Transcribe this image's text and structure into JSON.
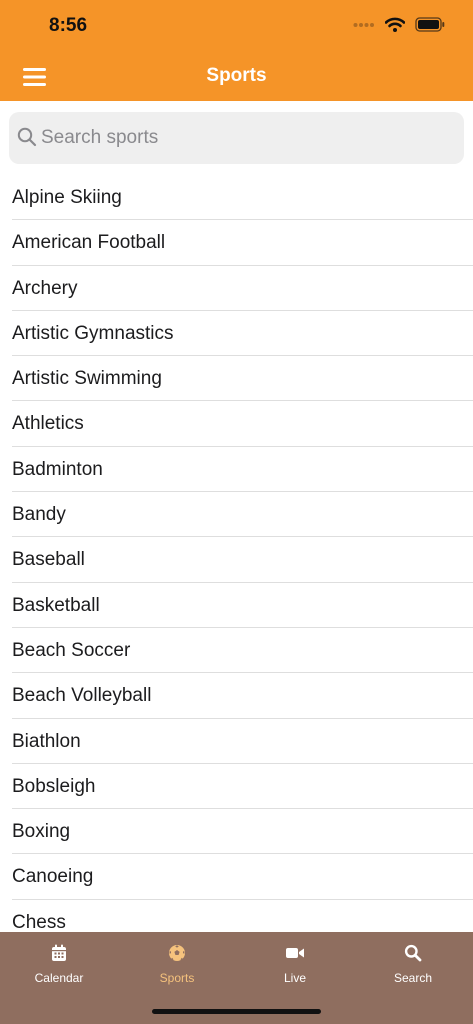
{
  "status_bar": {
    "time": "8:56"
  },
  "nav": {
    "title": "Sports"
  },
  "search": {
    "placeholder": "Search sports",
    "value": ""
  },
  "sports": [
    "Alpine Skiing",
    "American Football",
    "Archery",
    "Artistic Gymnastics",
    "Artistic Swimming",
    "Athletics",
    "Badminton",
    "Bandy",
    "Baseball",
    "Basketball",
    "Beach Soccer",
    "Beach Volleyball",
    "Biathlon",
    "Bobsleigh",
    "Boxing",
    "Canoeing",
    "Chess"
  ],
  "tabs": [
    {
      "label": "Calendar",
      "icon": "calendar-icon"
    },
    {
      "label": "Sports",
      "icon": "soccer-ball-icon",
      "active": true
    },
    {
      "label": "Live",
      "icon": "video-camera-icon"
    },
    {
      "label": "Search",
      "icon": "search-icon"
    }
  ],
  "colors": {
    "header": "#f59428",
    "tabbar": "#8f6e5f",
    "tab_active": "#f5c27d",
    "tab_inactive": "#ffffff"
  }
}
